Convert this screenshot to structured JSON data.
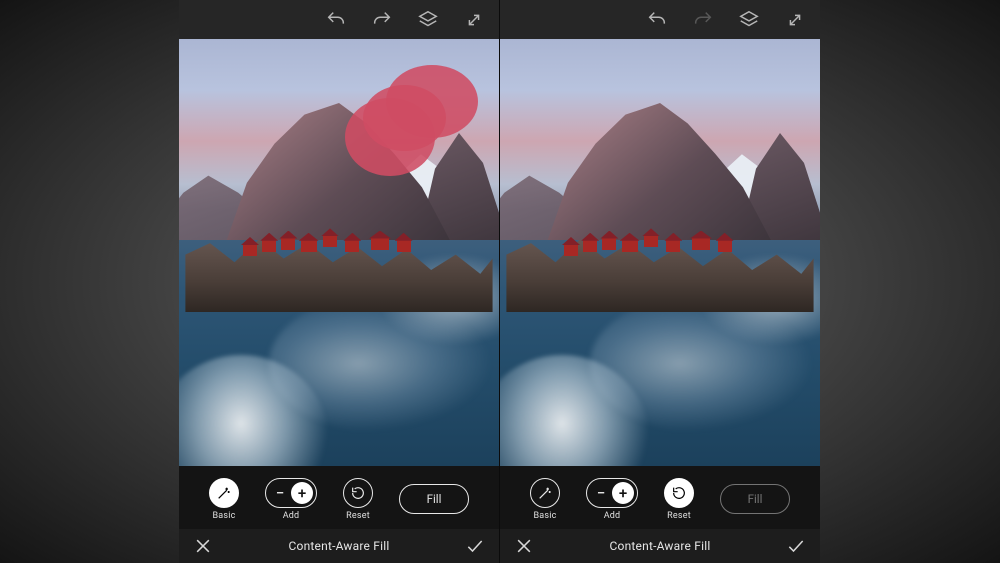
{
  "panes": [
    {
      "id": "before",
      "has_mask": true,
      "topbar": {
        "undo_enabled": true,
        "redo_enabled": true
      },
      "tools": {
        "basic_label": "Basic",
        "add_label": "Add",
        "reset_label": "Reset",
        "fill_label": "Fill",
        "active": "basic",
        "fill_enabled": true
      },
      "titlebar": {
        "title": "Content-Aware Fill"
      }
    },
    {
      "id": "after",
      "has_mask": false,
      "topbar": {
        "undo_enabled": true,
        "redo_enabled": false
      },
      "tools": {
        "basic_label": "Basic",
        "add_label": "Add",
        "reset_label": "Reset",
        "fill_label": "Fill",
        "active": "reset",
        "fill_enabled": false
      },
      "titlebar": {
        "title": "Content-Aware Fill"
      }
    }
  ],
  "icons": {
    "undo": "undo-icon",
    "redo": "redo-icon",
    "layers": "layers-icon",
    "expand": "expand-icon",
    "cancel": "close-icon",
    "confirm": "check-icon"
  },
  "mask_color": "#cf4c63"
}
